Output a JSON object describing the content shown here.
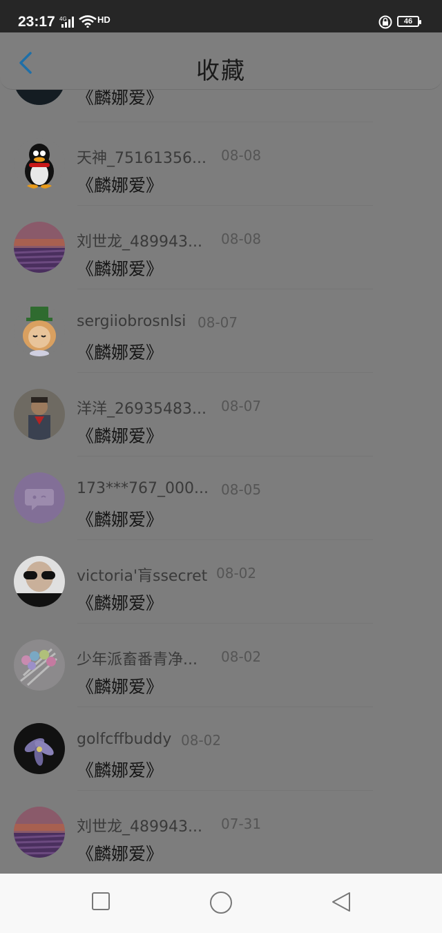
{
  "status_bar": {
    "time": "23:17",
    "network": "4G",
    "hd": "HD",
    "battery": "46"
  },
  "header": {
    "title": "收藏",
    "back_icon": "chevron-left-icon"
  },
  "items": [
    {
      "name": "",
      "date": "",
      "title": "《麟娜爱》",
      "avatar": "dark-scene"
    },
    {
      "name": "天神_75161356...",
      "date": "08-08",
      "title": "《麟娜爱》",
      "avatar": "qq-penguin"
    },
    {
      "name": "刘世龙_489943...",
      "date": "08-08",
      "title": "《麟娜爱》",
      "avatar": "lavender-field"
    },
    {
      "name": "sergiiobrosnlsi",
      "date": "08-07",
      "title": "《麟娜爱》",
      "avatar": "cartoon-hat"
    },
    {
      "name": "洋洋_26935483...",
      "date": "08-07",
      "title": "《麟娜爱》",
      "avatar": "child-photo"
    },
    {
      "name": "173***767_000...",
      "date": "08-05",
      "title": "《麟娜爱》",
      "avatar": "chat-bubble"
    },
    {
      "name": "victoria'肓ssecret",
      "date": "08-02",
      "title": "《麟娜爱》",
      "avatar": "sunglasses"
    },
    {
      "name": "少年派畜番青净...",
      "date": "08-02",
      "title": "《麟娜爱》",
      "avatar": "colorful-pens"
    },
    {
      "name": "golfcffbuddy",
      "date": "08-02",
      "title": "《麟娜爱》",
      "avatar": "iris-flower"
    },
    {
      "name": "刘世龙_489943...",
      "date": "07-31",
      "title": "《麟娜爱》",
      "avatar": "lavender-field"
    }
  ],
  "nav": {
    "recent": "square-icon",
    "home": "circle-icon",
    "back": "triangle-back-icon"
  }
}
